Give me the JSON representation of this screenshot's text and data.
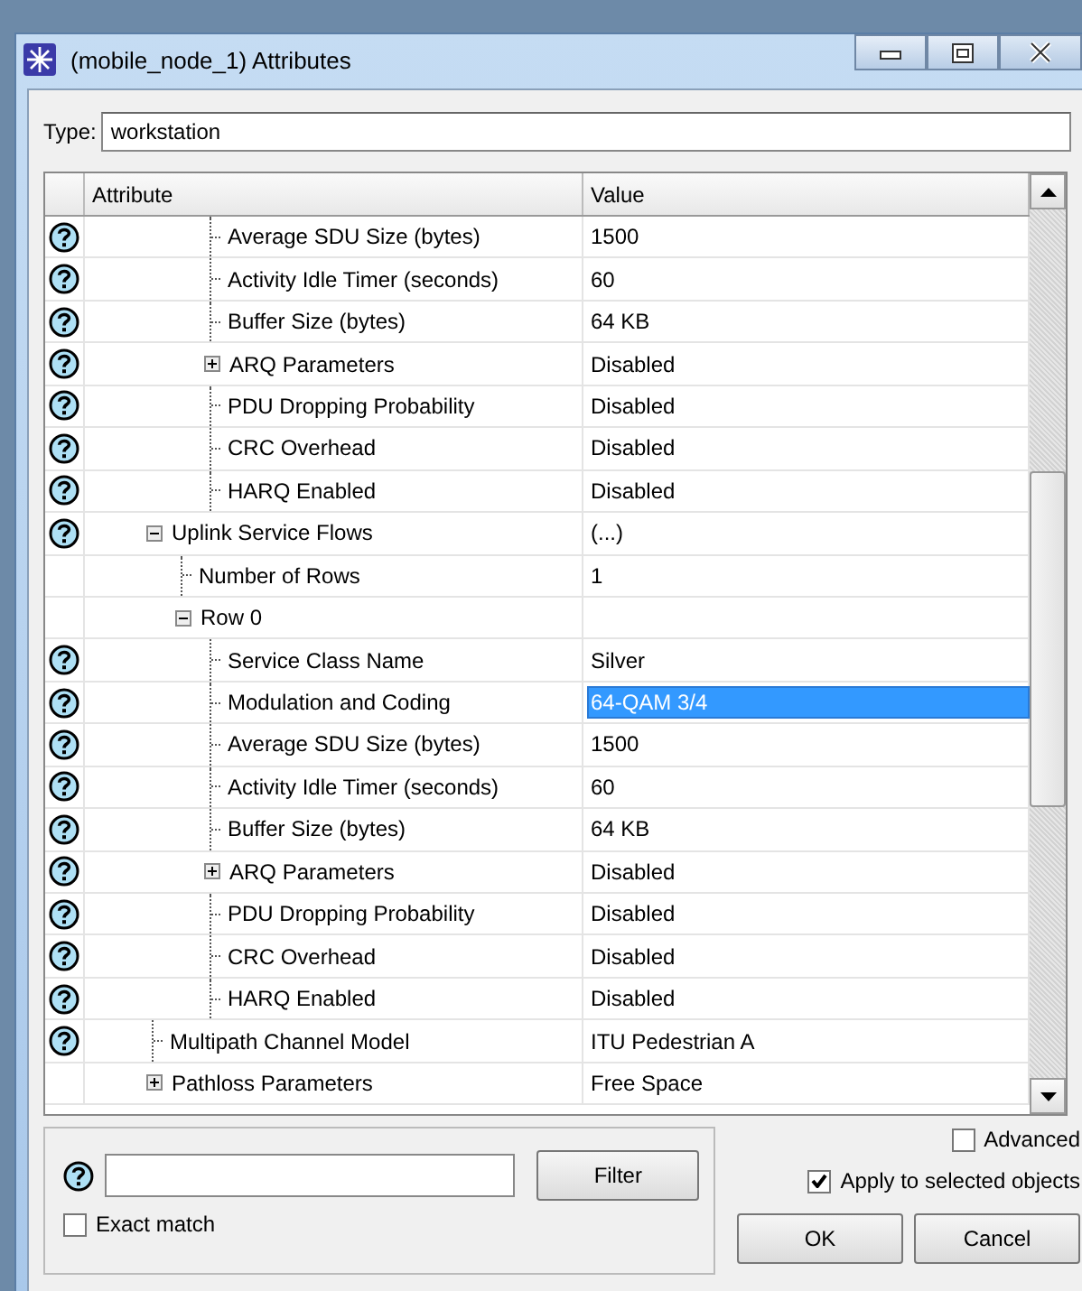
{
  "window": {
    "title": "(mobile_node_1) Attributes"
  },
  "type_field": {
    "label": "Type:",
    "value": "workstation"
  },
  "table": {
    "columns": [
      "Attribute",
      "Value"
    ],
    "rows": [
      {
        "children": [
          {
            "children": [
              {
                "label": "Average SDU Size (bytes)",
                "value": "1500",
                "help": true,
                "selected": false
              },
              {
                "label": "Activity Idle Timer (seconds)",
                "value": "60",
                "help": true,
                "selected": false
              },
              {
                "label": "Buffer Size (bytes)",
                "value": "64 KB",
                "help": true,
                "selected": false
              },
              {
                "label": "ARQ Parameters",
                "value": "Disabled",
                "help": true,
                "selected": false,
                "expanded": false
              },
              {
                "label": "PDU Dropping Probability",
                "value": "Disabled",
                "help": true,
                "selected": false
              },
              {
                "label": "CRC Overhead",
                "value": "Disabled",
                "help": true,
                "selected": false
              },
              {
                "label": "HARQ Enabled",
                "value": "Disabled",
                "help": true,
                "selected": false
              }
            ]
          }
        ]
      },
      {
        "label": "Uplink Service Flows",
        "value": "(...)",
        "help": true,
        "selected": false,
        "expanded": true,
        "children": [
          {
            "label": "Number of Rows",
            "value": "1",
            "help": false,
            "selected": false
          },
          {
            "label": "Row 0",
            "help": false,
            "selected": false,
            "expanded": true,
            "children": [
              {
                "label": "Service Class Name",
                "value": "Silver",
                "help": true,
                "selected": false
              },
              {
                "label": "Modulation and Coding",
                "value": "64-QAM 3/4",
                "help": true,
                "selected": true
              },
              {
                "label": "Average SDU Size (bytes)",
                "value": "1500",
                "help": true,
                "selected": false
              },
              {
                "label": "Activity Idle Timer (seconds)",
                "value": "60",
                "help": true,
                "selected": false
              },
              {
                "label": "Buffer Size (bytes)",
                "value": "64 KB",
                "help": true,
                "selected": false
              },
              {
                "label": "ARQ Parameters",
                "value": "Disabled",
                "help": true,
                "selected": false,
                "expanded": false
              },
              {
                "label": "PDU Dropping Probability",
                "value": "Disabled",
                "help": true,
                "selected": false
              },
              {
                "label": "CRC Overhead",
                "value": "Disabled",
                "help": true,
                "selected": false
              },
              {
                "label": "HARQ Enabled",
                "value": "Disabled",
                "help": true,
                "selected": false
              }
            ]
          }
        ]
      },
      {
        "label": "Multipath Channel Model",
        "value": "ITU Pedestrian A",
        "help": true,
        "selected": false
      },
      {
        "label": "Pathloss Parameters",
        "value": "Free Space",
        "help": false,
        "selected": false,
        "expanded": false
      }
    ]
  },
  "filter": {
    "button": "Filter",
    "exact_match": {
      "label": "Exact match",
      "checked": false
    }
  },
  "options": [
    {
      "label": "Advanced",
      "checked": false
    },
    {
      "label": "Apply to selected objects",
      "checked": true
    }
  ],
  "buttons": [
    "OK",
    "Cancel"
  ]
}
